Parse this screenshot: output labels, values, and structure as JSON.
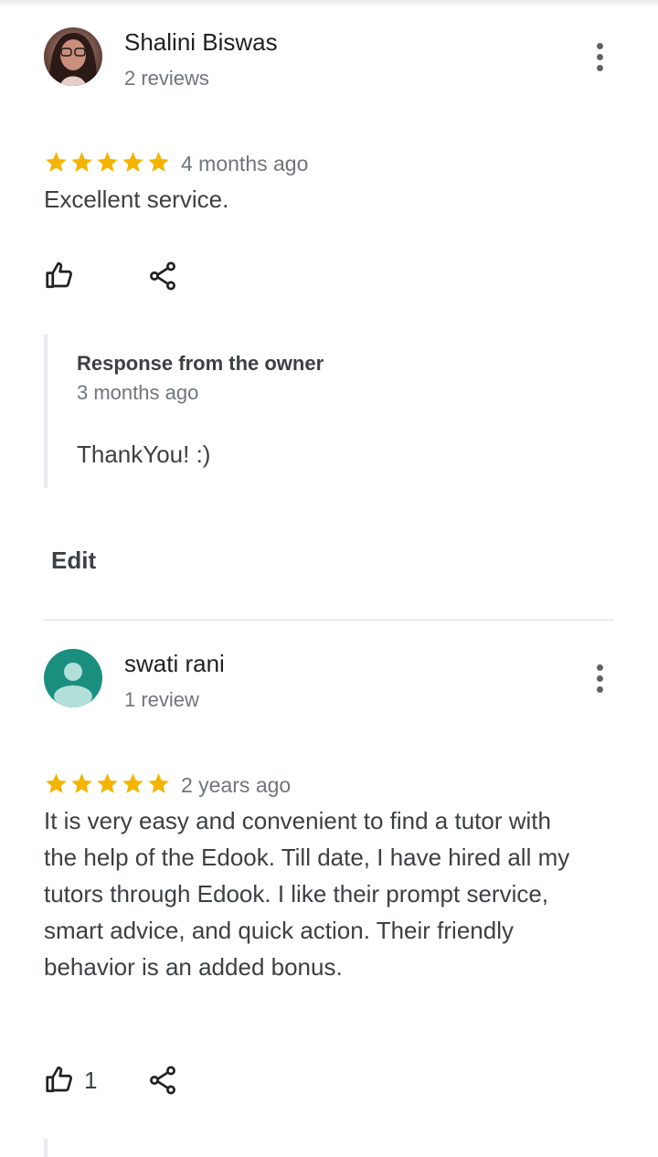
{
  "colors": {
    "star": "#f4b400",
    "avatar_default": "#1a8f7f",
    "secondary_text": "#70757a"
  },
  "reviews": [
    {
      "author": "Shalini Biswas",
      "review_count": "2 reviews",
      "rating": 5,
      "date": "4 months ago",
      "text": "Excellent service.",
      "likes": "",
      "owner_response": {
        "title": "Response from the owner",
        "date": "3 months ago",
        "text": "ThankYou! :)"
      },
      "edit_label": "Edit"
    },
    {
      "author": "swati rani",
      "review_count": "1 review",
      "rating": 5,
      "date": "2 years ago",
      "text": "It is very easy and convenient to find a tutor with the help of the Edook. Till date, I have hired all my tutors through Edook. I like their prompt service, smart advice, and quick action. Their friendly behavior is an added bonus.",
      "likes": "1"
    }
  ],
  "icons": [
    "more-vert-icon",
    "star-icon",
    "thumbs-up-icon",
    "share-icon",
    "default-avatar-icon"
  ]
}
